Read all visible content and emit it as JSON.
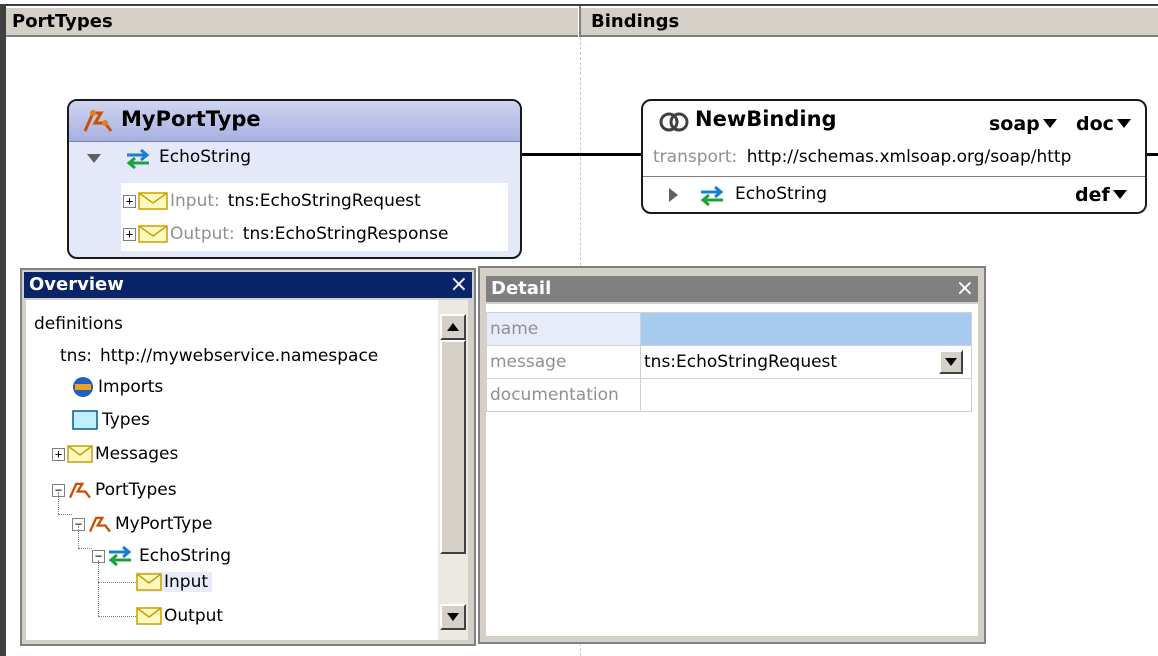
{
  "columns": {
    "porttypes": "PortTypes",
    "bindings": "Bindings"
  },
  "porttype": {
    "title": "MyPortType",
    "operation": "EchoString",
    "input_label": "Input:",
    "input_value": "tns:EchoStringRequest",
    "output_label": "Output:",
    "output_value": "tns:EchoStringResponse"
  },
  "binding": {
    "title": "NewBinding",
    "protocol": "soap",
    "style": "doc",
    "transport_label": "transport:",
    "transport_value": "http://schemas.xmlsoap.org/soap/http",
    "operation": "EchoString",
    "op_style": "def"
  },
  "overview": {
    "title": "Overview",
    "close": "×",
    "items": {
      "definitions": "definitions",
      "tns_prefix": "tns:",
      "tns_value": "http://mywebservice.namespace",
      "imports": "Imports",
      "types": "Types",
      "messages": "Messages",
      "porttypes": "PortTypes",
      "myporttype": "MyPortType",
      "echostring": "EchoString",
      "input": "Input",
      "output": "Output"
    }
  },
  "detail": {
    "title": "Detail",
    "close": "×",
    "rows": [
      {
        "key": "name",
        "value": ""
      },
      {
        "key": "message",
        "value": "tns:EchoStringRequest"
      },
      {
        "key": "documentation",
        "value": ""
      }
    ]
  },
  "colors": {
    "overview_title_bg": "#0a246a",
    "detail_title_bg": "#808080",
    "porttype_bg": "#e4e8f8",
    "selected_cell": "#a6caf0",
    "operation_arrow": "#1a7fd0"
  }
}
